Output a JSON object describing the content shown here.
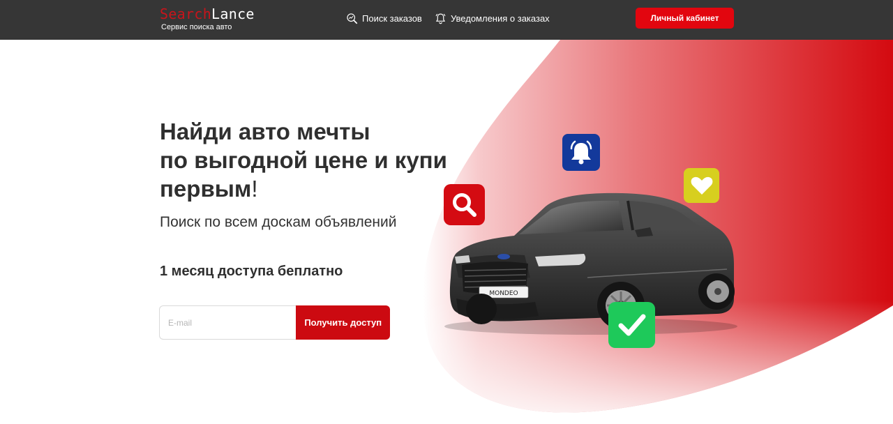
{
  "header": {
    "logo": {
      "part1": "Search",
      "part2": "Lance",
      "tagline": "Сервис поиска авто"
    },
    "nav": [
      {
        "label": "Поиск заказов",
        "icon": "search-chart-icon"
      },
      {
        "label": "Уведомления о заказах",
        "icon": "bell-icon"
      }
    ],
    "cabinet_button": "Личный кабинет"
  },
  "hero": {
    "headline": [
      "Найди авто мечты",
      "по выгодной цене и купи",
      "первым"
    ],
    "headline_punct": "!",
    "subhead": "Поиск по всем доскам объявлений",
    "offer": "1 месяц доступа беплатно",
    "form": {
      "email_placeholder": "E-mail",
      "email_value": "",
      "submit_label": "Получить доступ"
    },
    "car_plate": "MONDEO",
    "badges": [
      "search-icon",
      "bell-icon",
      "heart-icon",
      "check-icon"
    ]
  },
  "colors": {
    "header_bg": "#363636",
    "accent_red": "#e2060f",
    "button_red": "#cc0a11",
    "badge_blue": "#13399b",
    "badge_yellow": "#d7cf1f",
    "badge_green": "#1ec95a"
  }
}
